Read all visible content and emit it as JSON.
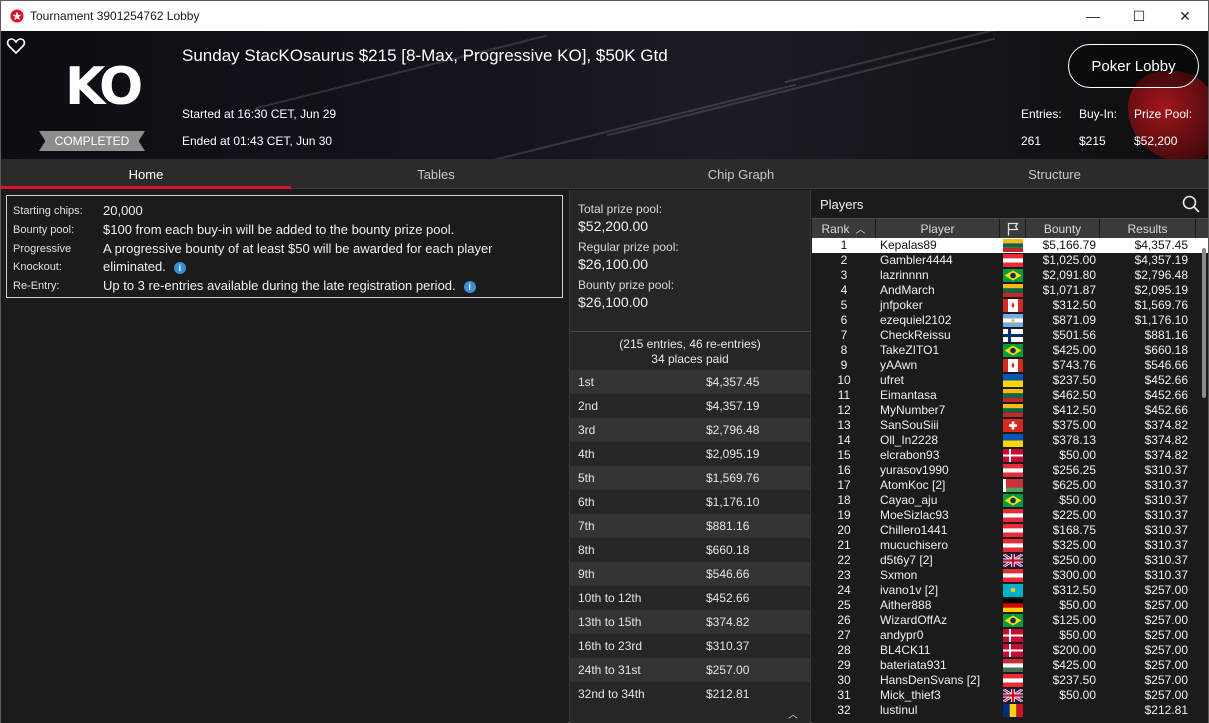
{
  "window": {
    "title": "Tournament 3901254762 Lobby",
    "minimize": "—",
    "maximize": "☐",
    "close": "✕"
  },
  "banner": {
    "logo": "KO",
    "status": "COMPLETED",
    "title": "Sunday StacKOsaurus $215 [8-Max, Progressive KO], $50K Gtd",
    "started": "Started at 16:30 CET, Jun 29",
    "ended": "Ended at 01:43 CET, Jun 30",
    "lobby_button": "Poker Lobby",
    "entries_label": "Entries:",
    "entries_value": "261",
    "buyin_label": "Buy-In:",
    "buyin_value": "$215",
    "prizepool_label": "Prize Pool:",
    "prizepool_value": "$52,200"
  },
  "tabs": [
    "Home",
    "Tables",
    "Chip Graph",
    "Structure"
  ],
  "info": [
    {
      "key": "Starting chips:",
      "value": "20,000",
      "info": false
    },
    {
      "key": "Bounty pool:",
      "value": "$100 from each buy-in will be added to the bounty prize pool.",
      "info": false
    },
    {
      "key": "Progressive Knockout:",
      "value": "A progressive bounty of at least $50 will be awarded for each player eliminated.",
      "info": true
    },
    {
      "key": "Re-Entry:",
      "value": "Up to 3 re-entries available during the late registration period.",
      "info": true
    }
  ],
  "prize": {
    "total_label": "Total prize pool:",
    "total_value": "$52,200.00",
    "regular_label": "Regular prize pool:",
    "regular_value": "$26,100.00",
    "bounty_label": "Bounty prize pool:",
    "bounty_value": "$26,100.00",
    "entries_summary": "(215 entries, 46 re-entries)",
    "places_paid": "34 places paid",
    "payouts": [
      {
        "place": "1st",
        "prize": "$4,357.45"
      },
      {
        "place": "2nd",
        "prize": "$4,357.19"
      },
      {
        "place": "3rd",
        "prize": "$2,796.48"
      },
      {
        "place": "4th",
        "prize": "$2,095.19"
      },
      {
        "place": "5th",
        "prize": "$1,569.76"
      },
      {
        "place": "6th",
        "prize": "$1,176.10"
      },
      {
        "place": "7th",
        "prize": "$881.16"
      },
      {
        "place": "8th",
        "prize": "$660.18"
      },
      {
        "place": "9th",
        "prize": "$546.66"
      },
      {
        "place": "10th to 12th",
        "prize": "$452.66"
      },
      {
        "place": "13th to 15th",
        "prize": "$374.82"
      },
      {
        "place": "16th to 23rd",
        "prize": "$310.37"
      },
      {
        "place": "24th to 31st",
        "prize": "$257.00"
      },
      {
        "place": "32nd to 34th",
        "prize": "$212.81"
      }
    ]
  },
  "players": {
    "header": "Players",
    "columns": {
      "rank": "Rank",
      "player": "Player",
      "bounty": "Bounty",
      "results": "Results"
    },
    "rows": [
      {
        "rank": "1",
        "player": "Kepalas89",
        "flag": "lithuania",
        "bounty": "$5,166.79",
        "result": "$4,357.45"
      },
      {
        "rank": "2",
        "player": "Gambler4444",
        "flag": "austria",
        "bounty": "$1,025.00",
        "result": "$4,357.19"
      },
      {
        "rank": "3",
        "player": "lazrinnnn",
        "flag": "brazil",
        "bounty": "$2,091.80",
        "result": "$2,796.48"
      },
      {
        "rank": "4",
        "player": "AndMarch",
        "flag": "lithuania",
        "bounty": "$1,071.87",
        "result": "$2,095.19"
      },
      {
        "rank": "5",
        "player": "jnfpoker",
        "flag": "canada",
        "bounty": "$312.50",
        "result": "$1,569.76"
      },
      {
        "rank": "6",
        "player": "ezequiel2102",
        "flag": "argentina",
        "bounty": "$871.09",
        "result": "$1,176.10"
      },
      {
        "rank": "7",
        "player": "CheckReissu",
        "flag": "finland",
        "bounty": "$501.56",
        "result": "$881.16"
      },
      {
        "rank": "8",
        "player": "TakeZITO1",
        "flag": "brazil",
        "bounty": "$425.00",
        "result": "$660.18"
      },
      {
        "rank": "9",
        "player": "yAAwn",
        "flag": "canada",
        "bounty": "$743.76",
        "result": "$546.66"
      },
      {
        "rank": "10",
        "player": "ufret",
        "flag": "ukraine",
        "bounty": "$237.50",
        "result": "$452.66"
      },
      {
        "rank": "11",
        "player": "Eimantasa",
        "flag": "lithuania",
        "bounty": "$462.50",
        "result": "$452.66"
      },
      {
        "rank": "12",
        "player": "MyNumber7",
        "flag": "lithuania",
        "bounty": "$412.50",
        "result": "$452.66"
      },
      {
        "rank": "13",
        "player": "SanSouSiii",
        "flag": "switzerland",
        "bounty": "$375.00",
        "result": "$374.82"
      },
      {
        "rank": "14",
        "player": "Oll_In2228",
        "flag": "ukraine",
        "bounty": "$378.13",
        "result": "$374.82"
      },
      {
        "rank": "15",
        "player": "elcrabon93",
        "flag": "denmark",
        "bounty": "$50.00",
        "result": "$374.82"
      },
      {
        "rank": "16",
        "player": "yurasov1990",
        "flag": "austria",
        "bounty": "$256.25",
        "result": "$310.37"
      },
      {
        "rank": "17",
        "player": "AtomKoc [2]",
        "flag": "belarus",
        "bounty": "$625.00",
        "result": "$310.37"
      },
      {
        "rank": "18",
        "player": "Cayao_aju",
        "flag": "brazil",
        "bounty": "$50.00",
        "result": "$310.37"
      },
      {
        "rank": "19",
        "player": "MoeSizlac93",
        "flag": "austria",
        "bounty": "$225.00",
        "result": "$310.37"
      },
      {
        "rank": "20",
        "player": "Chillero1441",
        "flag": "austria",
        "bounty": "$168.75",
        "result": "$310.37"
      },
      {
        "rank": "21",
        "player": "mucuchisero",
        "flag": "austria",
        "bounty": "$325.00",
        "result": "$310.37"
      },
      {
        "rank": "22",
        "player": "d5t6y7 [2]",
        "flag": "uk",
        "bounty": "$250.00",
        "result": "$310.37"
      },
      {
        "rank": "23",
        "player": "Sxmon",
        "flag": "austria",
        "bounty": "$300.00",
        "result": "$310.37"
      },
      {
        "rank": "24",
        "player": "ivano1v [2]",
        "flag": "kazakhstan",
        "bounty": "$312.50",
        "result": "$257.00"
      },
      {
        "rank": "25",
        "player": "Aither888",
        "flag": "germany",
        "bounty": "$50.00",
        "result": "$257.00"
      },
      {
        "rank": "26",
        "player": "WizardOffAz",
        "flag": "brazil",
        "bounty": "$125.00",
        "result": "$257.00"
      },
      {
        "rank": "27",
        "player": "andypr0",
        "flag": "denmark",
        "bounty": "$50.00",
        "result": "$257.00"
      },
      {
        "rank": "28",
        "player": "BL4CK11",
        "flag": "denmark",
        "bounty": "$200.00",
        "result": "$257.00"
      },
      {
        "rank": "29",
        "player": "bateriata931",
        "flag": "hungary",
        "bounty": "$425.00",
        "result": "$257.00"
      },
      {
        "rank": "30",
        "player": "HansDenSvans [2]",
        "flag": "austria",
        "bounty": "$237.50",
        "result": "$257.00"
      },
      {
        "rank": "31",
        "player": "Mick_thief3",
        "flag": "uk",
        "bounty": "$50.00",
        "result": "$257.00"
      },
      {
        "rank": "32",
        "player": "lustinul",
        "flag": "romania",
        "bounty": "",
        "result": "$212.81"
      }
    ]
  }
}
